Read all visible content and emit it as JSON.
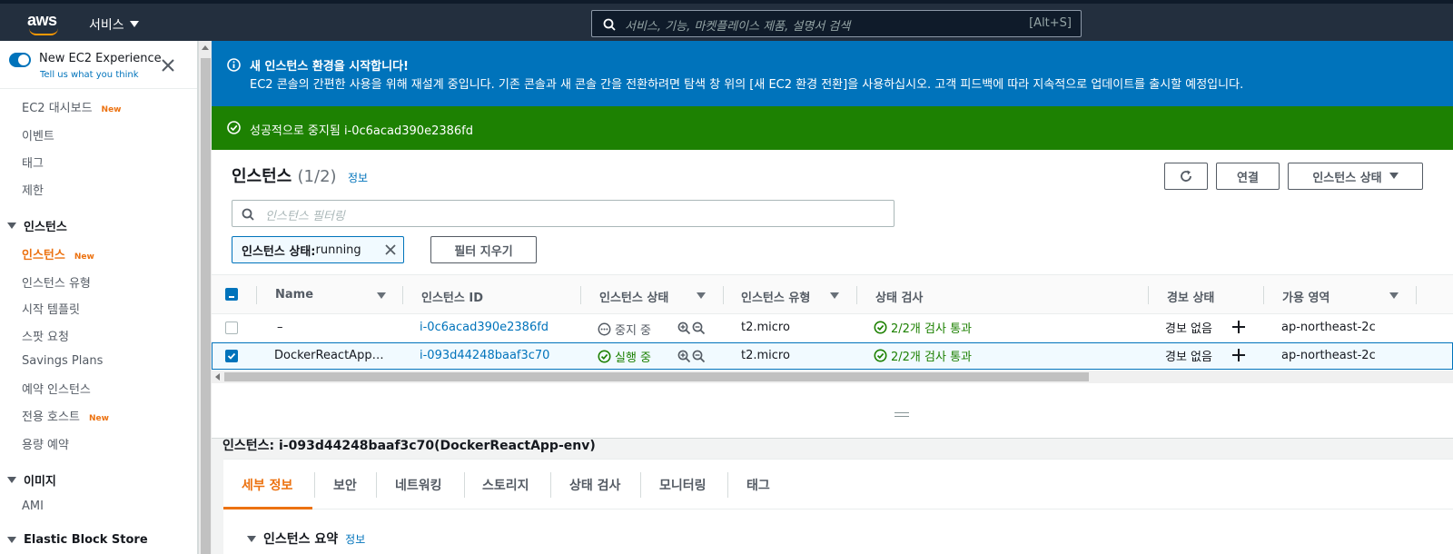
{
  "header": {
    "services_label": "서비스",
    "search_placeholder": "서비스, 기능, 마켓플레이스 제품, 설명서 검색",
    "search_shortcut": "[Alt+S]"
  },
  "sidebar": {
    "experience_title": "New EC2 Experience",
    "experience_sub": "Tell us what you think",
    "items": [
      {
        "label": "EC2 대시보드",
        "badge": "New"
      },
      {
        "label": "이벤트",
        "badge": ""
      },
      {
        "label": "태그",
        "badge": ""
      },
      {
        "label": "제한",
        "badge": ""
      }
    ],
    "section_instances": "인스턴스",
    "instance_items": [
      {
        "label": "인스턴스",
        "badge": "New"
      },
      {
        "label": "인스턴스 유형",
        "badge": ""
      },
      {
        "label": "시작 템플릿",
        "badge": ""
      },
      {
        "label": "스팟 요청",
        "badge": ""
      },
      {
        "label": "Savings Plans",
        "badge": ""
      },
      {
        "label": "예약 인스턴스",
        "badge": ""
      },
      {
        "label": "전용 호스트",
        "badge": "New"
      },
      {
        "label": "용량 예약",
        "badge": ""
      }
    ],
    "section_images": "이미지",
    "image_items": [
      {
        "label": "AMI"
      }
    ],
    "section_ebs": "Elastic Block Store"
  },
  "banners": {
    "info_title": "새 인스턴스 환경을 시작합니다!",
    "info_body": "EC2 콘솔의 간편한 사용을 위해 재설계 중입니다. 기존 콘솔과 새 콘솔 간을 전환하려면 탐색 창 위의 [새 EC2 환경 전환]을 사용하십시오. 고객 피드백에 따라 지속적으로 업데이트를 출시할 예정입니다.",
    "success": "성공적으로 중지됨 i-0c6acad390e2386fd"
  },
  "instances": {
    "title": "인스턴스",
    "count": "(1/2)",
    "info_link": "정보",
    "connect_label": "연결",
    "state_menu_label": "인스턴스 상태",
    "filter_placeholder": "인스턴스 필터링",
    "chip_key": "인스턴스 상태:",
    "chip_value": " running",
    "clear_filters": "필터 지우기",
    "columns": [
      "Name",
      "인스턴스 ID",
      "인스턴스 상태",
      "인스턴스 유형",
      "상태 검사",
      "경보 상태",
      "가용 영역"
    ],
    "rows": [
      {
        "name": "–",
        "id": "i-0c6acad390e2386fd",
        "state": "중지 중",
        "type": "t2.micro",
        "check": "2/2개 검사 통과",
        "alarm": "경보 없음",
        "az": "ap-northeast-2c",
        "selected": false
      },
      {
        "name": "DockerReactApp…",
        "id": "i-093d44248baaf3c70",
        "state": "실행 중",
        "type": "t2.micro",
        "check": "2/2개 검사 통과",
        "alarm": "경보 없음",
        "az": "ap-northeast-2c",
        "selected": true
      }
    ]
  },
  "detail": {
    "title": "인스턴스: i-093d44248baaf3c70(DockerReactApp-env)",
    "tabs": [
      "세부 정보",
      "보안",
      "네트워킹",
      "스토리지",
      "상태 검사",
      "모니터링",
      "태그"
    ],
    "summary_label": "인스턴스 요약",
    "summary_link": "정보"
  },
  "colors": {
    "accent": "#ec7211",
    "link": "#0073bb",
    "success": "#1d8102",
    "nav": "#232f3e"
  }
}
